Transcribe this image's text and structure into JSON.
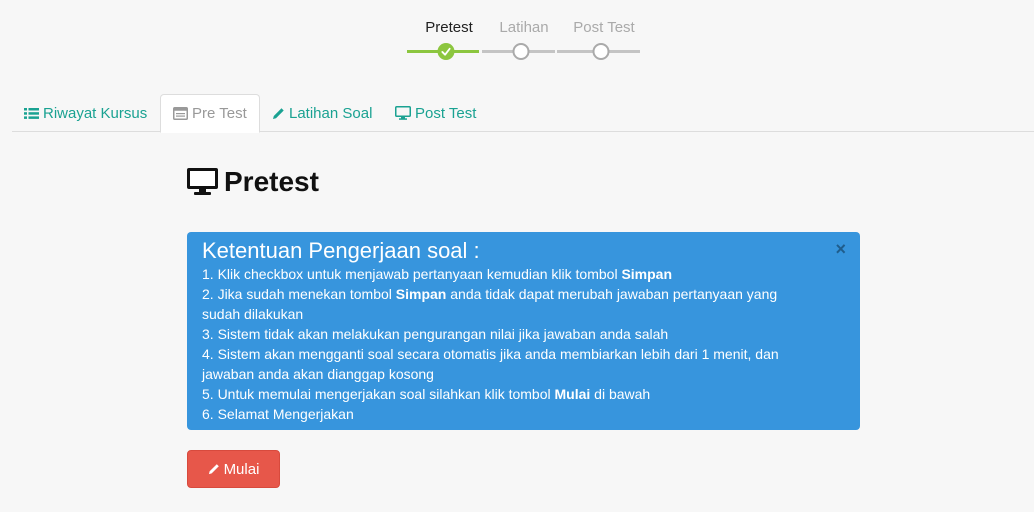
{
  "stepper": {
    "steps": [
      {
        "label": "Pretest",
        "state": "done"
      },
      {
        "label": "Latihan",
        "state": "todo"
      },
      {
        "label": "Post Test",
        "state": "todo"
      }
    ]
  },
  "tabs": [
    {
      "label": "Riwayat Kursus",
      "icon": "list-icon"
    },
    {
      "label": "Pre Test",
      "icon": "window-icon",
      "active": true
    },
    {
      "label": "Latihan Soal",
      "icon": "pencil-icon"
    },
    {
      "label": "Post Test",
      "icon": "desktop-icon"
    }
  ],
  "page": {
    "title": "Pretest",
    "title_icon": "desktop-icon"
  },
  "alert": {
    "title": "Ketentuan Pengerjaan soal :",
    "close_glyph": "×",
    "items": [
      {
        "pre": "1. Klik checkbox untuk menjawab pertanyaan kemudian klik tombol ",
        "bold": "Simpan",
        "post": ""
      },
      {
        "pre": "2. Jika sudah menekan tombol ",
        "bold": "Simpan",
        "post": " anda tidak dapat merubah jawaban pertanyaan yang sudah dilakukan"
      },
      {
        "pre": "3. Sistem tidak akan melakukan pengurangan nilai jika jawaban anda salah",
        "bold": "",
        "post": ""
      },
      {
        "pre": "4. Sistem akan mengganti soal secara otomatis jika anda membiarkan lebih dari 1 menit, dan jawaban anda akan dianggap kosong",
        "bold": "",
        "post": ""
      },
      {
        "pre": "5. Untuk memulai mengerjakan soal silahkan klik tombol ",
        "bold": "Mulai",
        "post": " di bawah"
      },
      {
        "pre": "6. Selamat Mengerjakan",
        "bold": "",
        "post": ""
      }
    ]
  },
  "actions": {
    "start_label": "Mulai",
    "start_icon": "pencil-icon"
  },
  "colors": {
    "accent": "#1aa292",
    "step_done": "#8cc63f",
    "alert_bg": "#3795dd",
    "button_danger": "#e7574a"
  }
}
